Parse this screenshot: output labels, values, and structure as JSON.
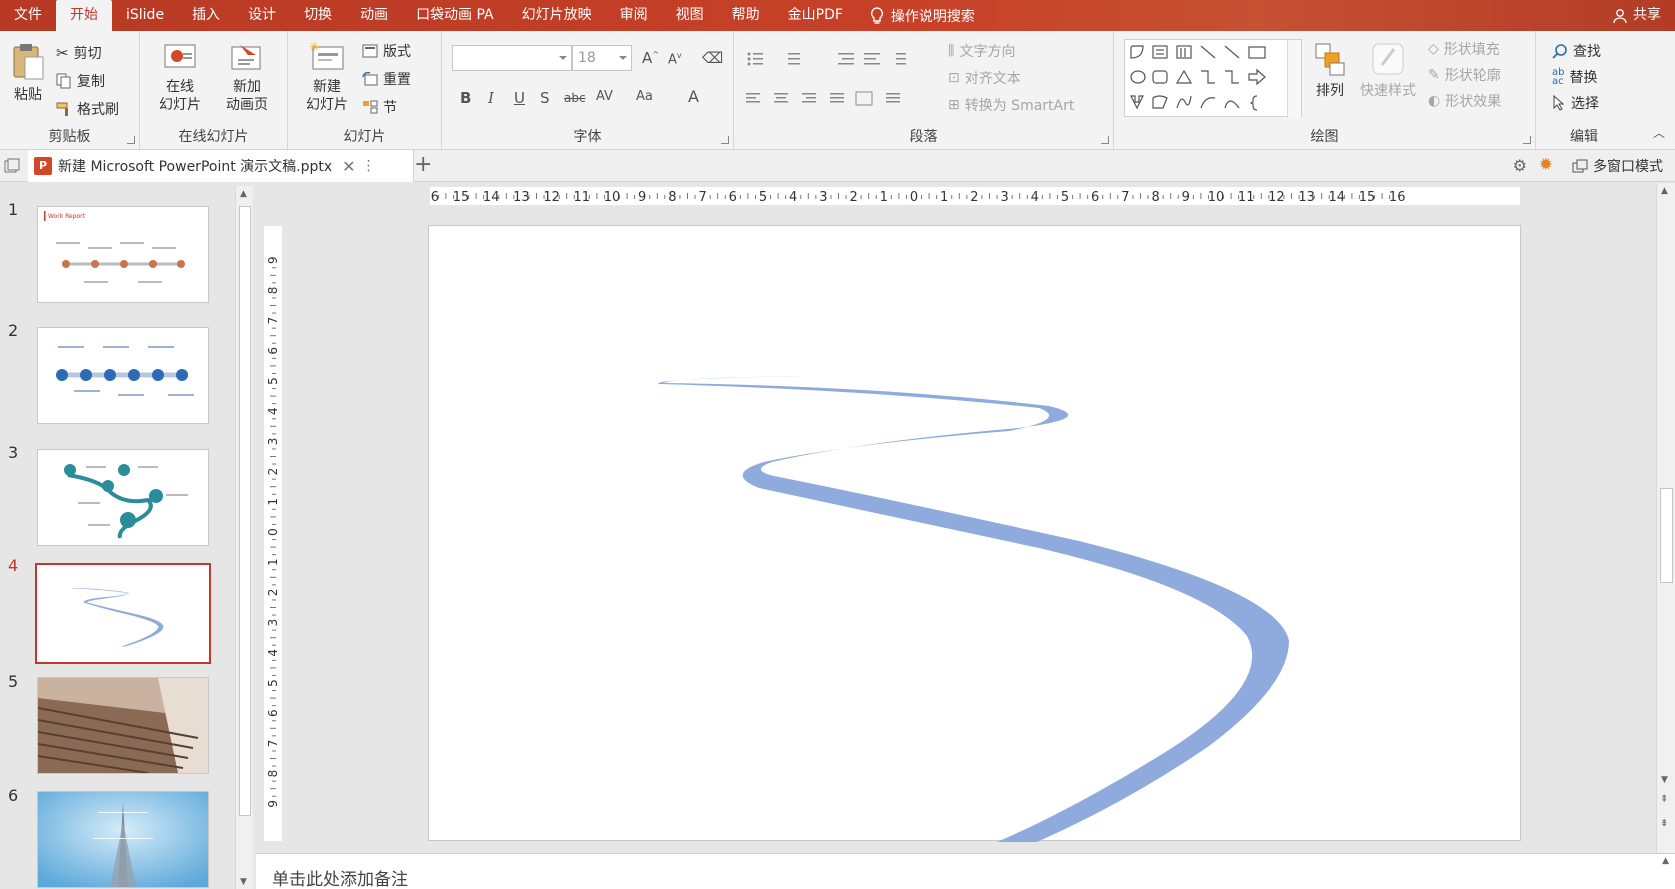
{
  "menu": {
    "tabs": [
      "文件",
      "开始",
      "iSlide",
      "插入",
      "设计",
      "切换",
      "动画",
      "口袋动画 PA",
      "幻灯片放映",
      "审阅",
      "视图",
      "帮助",
      "金山PDF"
    ],
    "active_tab": "开始",
    "search": "操作说明搜索",
    "share": "共享"
  },
  "ribbon": {
    "clipboard": {
      "label": "剪贴板",
      "paste": "粘贴",
      "cut": "剪切",
      "copy": "复制",
      "format_painter": "格式刷"
    },
    "online": {
      "label": "在线幻灯片",
      "online_slide_1": "在线",
      "online_slide_2": "幻灯片",
      "new_anim_1": "新加",
      "new_anim_2": "动画页"
    },
    "slides": {
      "label": "幻灯片",
      "new_slide_1": "新建",
      "new_slide_2": "幻灯片",
      "layout": "版式",
      "reset": "重置",
      "section": "节"
    },
    "font": {
      "label": "字体",
      "font_name": "",
      "font_size": "18"
    },
    "paragraph": {
      "label": "段落",
      "text_direction": "文字方向",
      "align_text": "对齐文本",
      "smartart": "转换为 SmartArt"
    },
    "drawing": {
      "label": "绘图",
      "arrange": "排列",
      "quick_styles": "快速样式",
      "shape_fill": "形状填充",
      "shape_outline": "形状轮廓",
      "shape_effects": "形状效果"
    },
    "editing": {
      "label": "编辑",
      "find": "查找",
      "replace": "替换",
      "select": "选择"
    }
  },
  "document": {
    "tab_title": "新建 Microsoft PowerPoint 演示文稿.pptx",
    "multi_window": "多窗口模式"
  },
  "thumbnails": [
    {
      "number": "1",
      "kind": "timeline-orange"
    },
    {
      "number": "2",
      "kind": "timeline-blue"
    },
    {
      "number": "3",
      "kind": "pins-teal"
    },
    {
      "number": "4",
      "kind": "curve",
      "selected": true
    },
    {
      "number": "5",
      "kind": "stairs-photo"
    },
    {
      "number": "6",
      "kind": "tower-photo"
    }
  ],
  "thumb1_title": "Work Report",
  "notes_placeholder": "单击此处添加备注",
  "colors": {
    "accent": "#c0392b",
    "curve": "#8faadc",
    "menubar": "#bd3d25"
  }
}
